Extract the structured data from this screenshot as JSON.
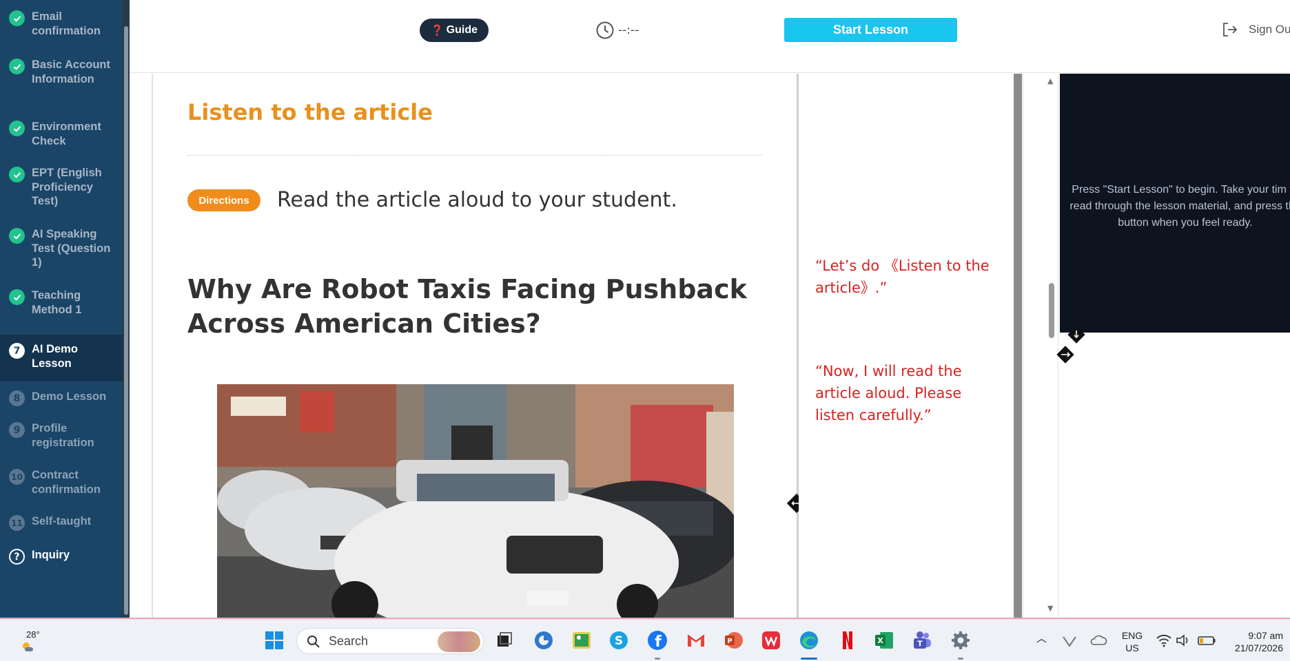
{
  "sidebar": {
    "steps": [
      {
        "marker": "",
        "label": "Email confirmation",
        "state": "done"
      },
      {
        "marker": "",
        "label": "Basic Account Information",
        "state": "done"
      },
      {
        "marker": "",
        "label": "Environment Check",
        "state": "done"
      },
      {
        "marker": "",
        "label": "EPT (English Proficiency Test)",
        "state": "done"
      },
      {
        "marker": "",
        "label": "AI Speaking Test (Question 1)",
        "state": "done"
      },
      {
        "marker": "",
        "label": "Teaching Method 1",
        "state": "done"
      },
      {
        "marker": "7",
        "label": "AI Demo Lesson",
        "state": "current"
      },
      {
        "marker": "8",
        "label": "Demo Lesson",
        "state": "pending"
      },
      {
        "marker": "9",
        "label": "Profile registration",
        "state": "pending"
      },
      {
        "marker": "10",
        "label": "Contract confirmation",
        "state": "pending"
      },
      {
        "marker": "11",
        "label": "Self-taught",
        "state": "pending"
      },
      {
        "marker": "?",
        "label": "Inquiry",
        "state": "help"
      }
    ]
  },
  "header": {
    "guide_label": "Guide",
    "timer": "--:--",
    "start_lesson_label": "Start Lesson",
    "sign_out_label": "Sign Ou"
  },
  "lesson": {
    "section_title": "Listen to the article",
    "directions_badge": "Directions",
    "directions_text": "Read the article aloud to your student.",
    "article_title": "Why Are Robot Taxis Facing Pushback Across American Cities?"
  },
  "script": {
    "lines": [
      "“Let’s do 《Listen to the article》.”",
      "“Now, I will read the article aloud. Please listen carefully.”"
    ]
  },
  "video_panel": {
    "message": "Press \"Start Lesson\" to begin. Take your tim to read through the lesson material, and press the button when you feel ready."
  },
  "taskbar": {
    "weather_temp": "28°",
    "search_placeholder": "Search",
    "language_line1": "ENG",
    "language_line2": "US",
    "time": "9:07 am",
    "date": "21/07/2026"
  },
  "colors": {
    "sidebar_bg": "#1a4567",
    "done_check": "#22c38e",
    "accent_orange": "#e8911f",
    "start_button": "#18c6ee",
    "script_red": "#d9211f"
  }
}
